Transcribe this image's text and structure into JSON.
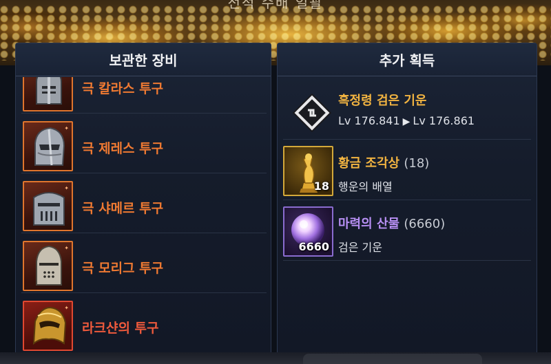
{
  "header_title": "전적 수배 일괄",
  "left_panel": {
    "title": "보관한 장비",
    "items": [
      {
        "name": "극 칼라스 투구",
        "grade": "orange",
        "icon": "helmet-visor-icon"
      },
      {
        "name": "극 제레스 투구",
        "grade": "orange",
        "icon": "helmet-knight-icon"
      },
      {
        "name": "극 샤메르 투구",
        "grade": "orange",
        "icon": "helmet-bucket-icon"
      },
      {
        "name": "극 모리그 투구",
        "grade": "orange",
        "icon": "helmet-pointed-icon"
      },
      {
        "name": "라크샨의 투구",
        "grade": "red",
        "icon": "helmet-gold-icon"
      }
    ]
  },
  "right_panel": {
    "title": "추가 획득",
    "rewards": [
      {
        "title": "흑정령 검은 기운",
        "lv_from": "Lv 176.841",
        "lv_to": "Lv 176.861",
        "icon": "spirit-rune-icon"
      },
      {
        "title": "황금 조각상",
        "count": "(18)",
        "sub": "행운의 배열",
        "badge": "18",
        "icon": "golden-statue-icon"
      },
      {
        "title": "마력의 산물",
        "count": "(6660)",
        "sub": "검은 기운",
        "badge": "6660",
        "icon": "magic-orb-icon"
      }
    ]
  },
  "colors": {
    "orange_grade": "#f07a32",
    "red_grade": "#f05a3c",
    "gold_text": "#f2b441",
    "purple_text": "#b890f5",
    "panel_bg": "#151c2b"
  }
}
